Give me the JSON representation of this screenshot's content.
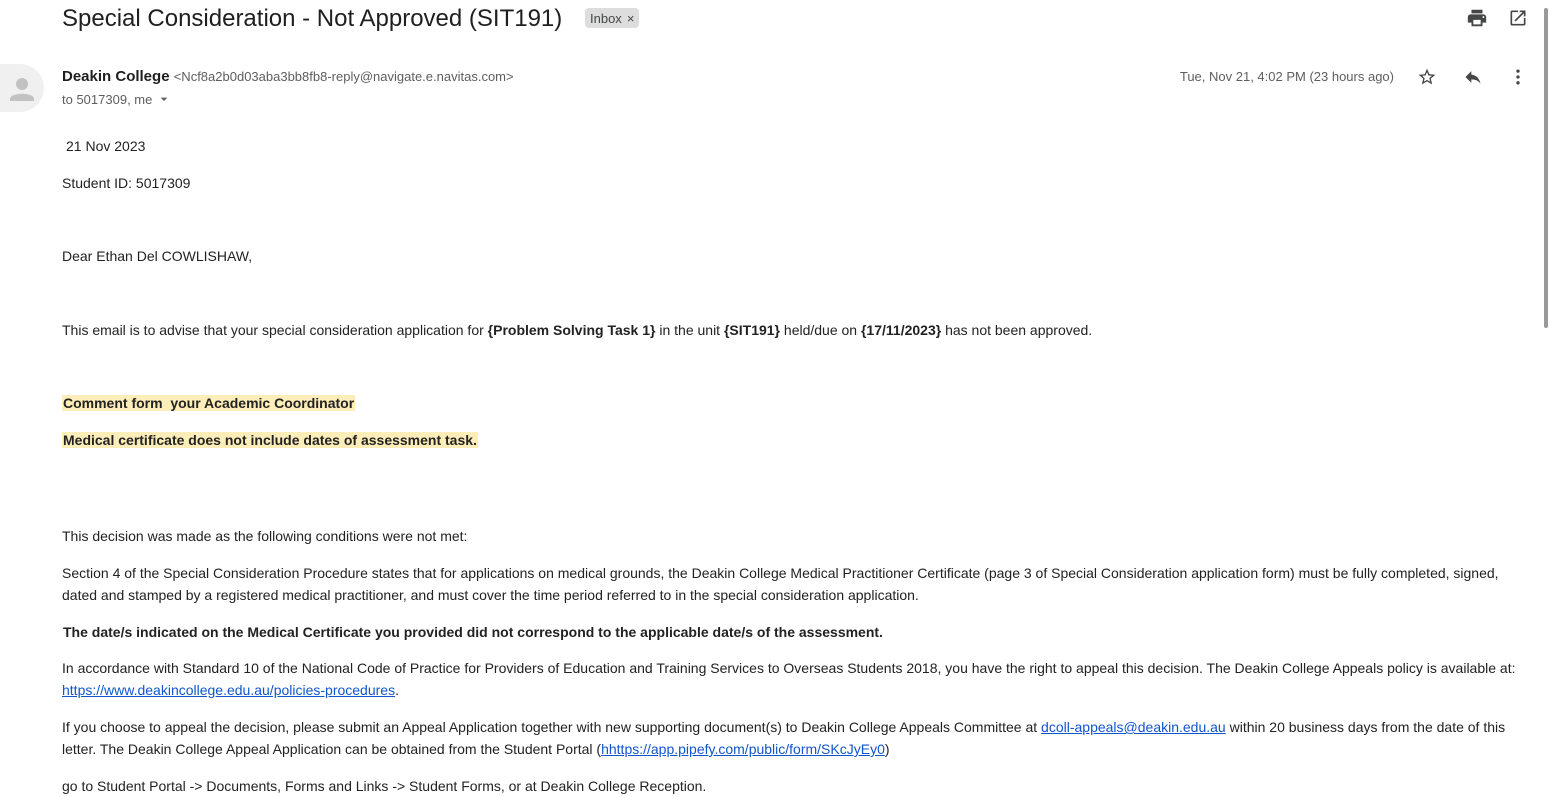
{
  "header": {
    "subject": "Special Consideration - Not Approved (SIT191)",
    "label": "Inbox",
    "label_close": "×"
  },
  "message": {
    "sender_name": "Deakin College",
    "sender_email": "<Ncf8a2b0d03aba3bb8fb8-reply@navigate.e.navitas.com>",
    "recipients": "to 5017309, me",
    "timestamp": "Tue, Nov 21, 4:02 PM (23 hours ago)"
  },
  "body": {
    "date": "21 Nov 2023",
    "student_id": "Student ID: 5017309",
    "greeting": "Dear Ethan Del COWLISHAW,",
    "advise": {
      "p1": "This email is to advise that your special consideration application for ",
      "task": "{Problem Solving Task 1}",
      "p2": " in the unit ",
      "unit": "{SIT191}",
      "p3": " held/due on ",
      "due": "{17/11/2023}",
      "p4": " has not been approved."
    },
    "comment_heading": "Comment form  your Academic Coordinator",
    "comment": "Medical certificate does not include dates of assessment task.",
    "decision": "This decision was made as the following conditions were not met:",
    "section4": "Section 4 of the Special Consideration Procedure states that for applications on medical grounds, the Deakin College Medical Practitioner Certificate (page 3 of Special Consideration application form) must be fully completed, signed, dated and stamped by a registered medical practitioner, and must cover the time period referred to in the special consideration application.",
    "dates_note": "The date/s indicated on the Medical Certificate you provided did not correspond to the applicable date/s of the assessment.",
    "standard": {
      "text": "In accordance with Standard 10 of the National Code of Practice for Providers of Education and Training Services to Overseas Students 2018, you have the right to appeal this decision.  The Deakin College Appeals policy is available at: ",
      "link": "https://www.deakincollege.edu.au/policies-procedures",
      "end": "."
    },
    "appeal": {
      "t1": "If you choose to appeal the decision, please submit an Appeal Application together with new supporting document(s) to Deakin College Appeals Committee at ",
      "email": "dcoll-appeals@deakin.edu.au",
      "t2": " within 20 business days from the date of this letter.  The Deakin College Appeal Application can be obtained from the Student Portal (",
      "link": "hhttps://app.pipefy.com/public/form/SKcJyEy0",
      "t3": ")"
    },
    "portal": "go to Student Portal -> Documents, Forms and Links -> Student Forms, or at Deakin College Reception."
  },
  "icons": {
    "print": "print-icon",
    "open_new_window": "open-in-new-window-icon",
    "star": "star-icon",
    "reply": "reply-icon",
    "more": "more-vert-icon",
    "avatar": "person-avatar-icon",
    "dropdown": "caret-down-icon"
  }
}
